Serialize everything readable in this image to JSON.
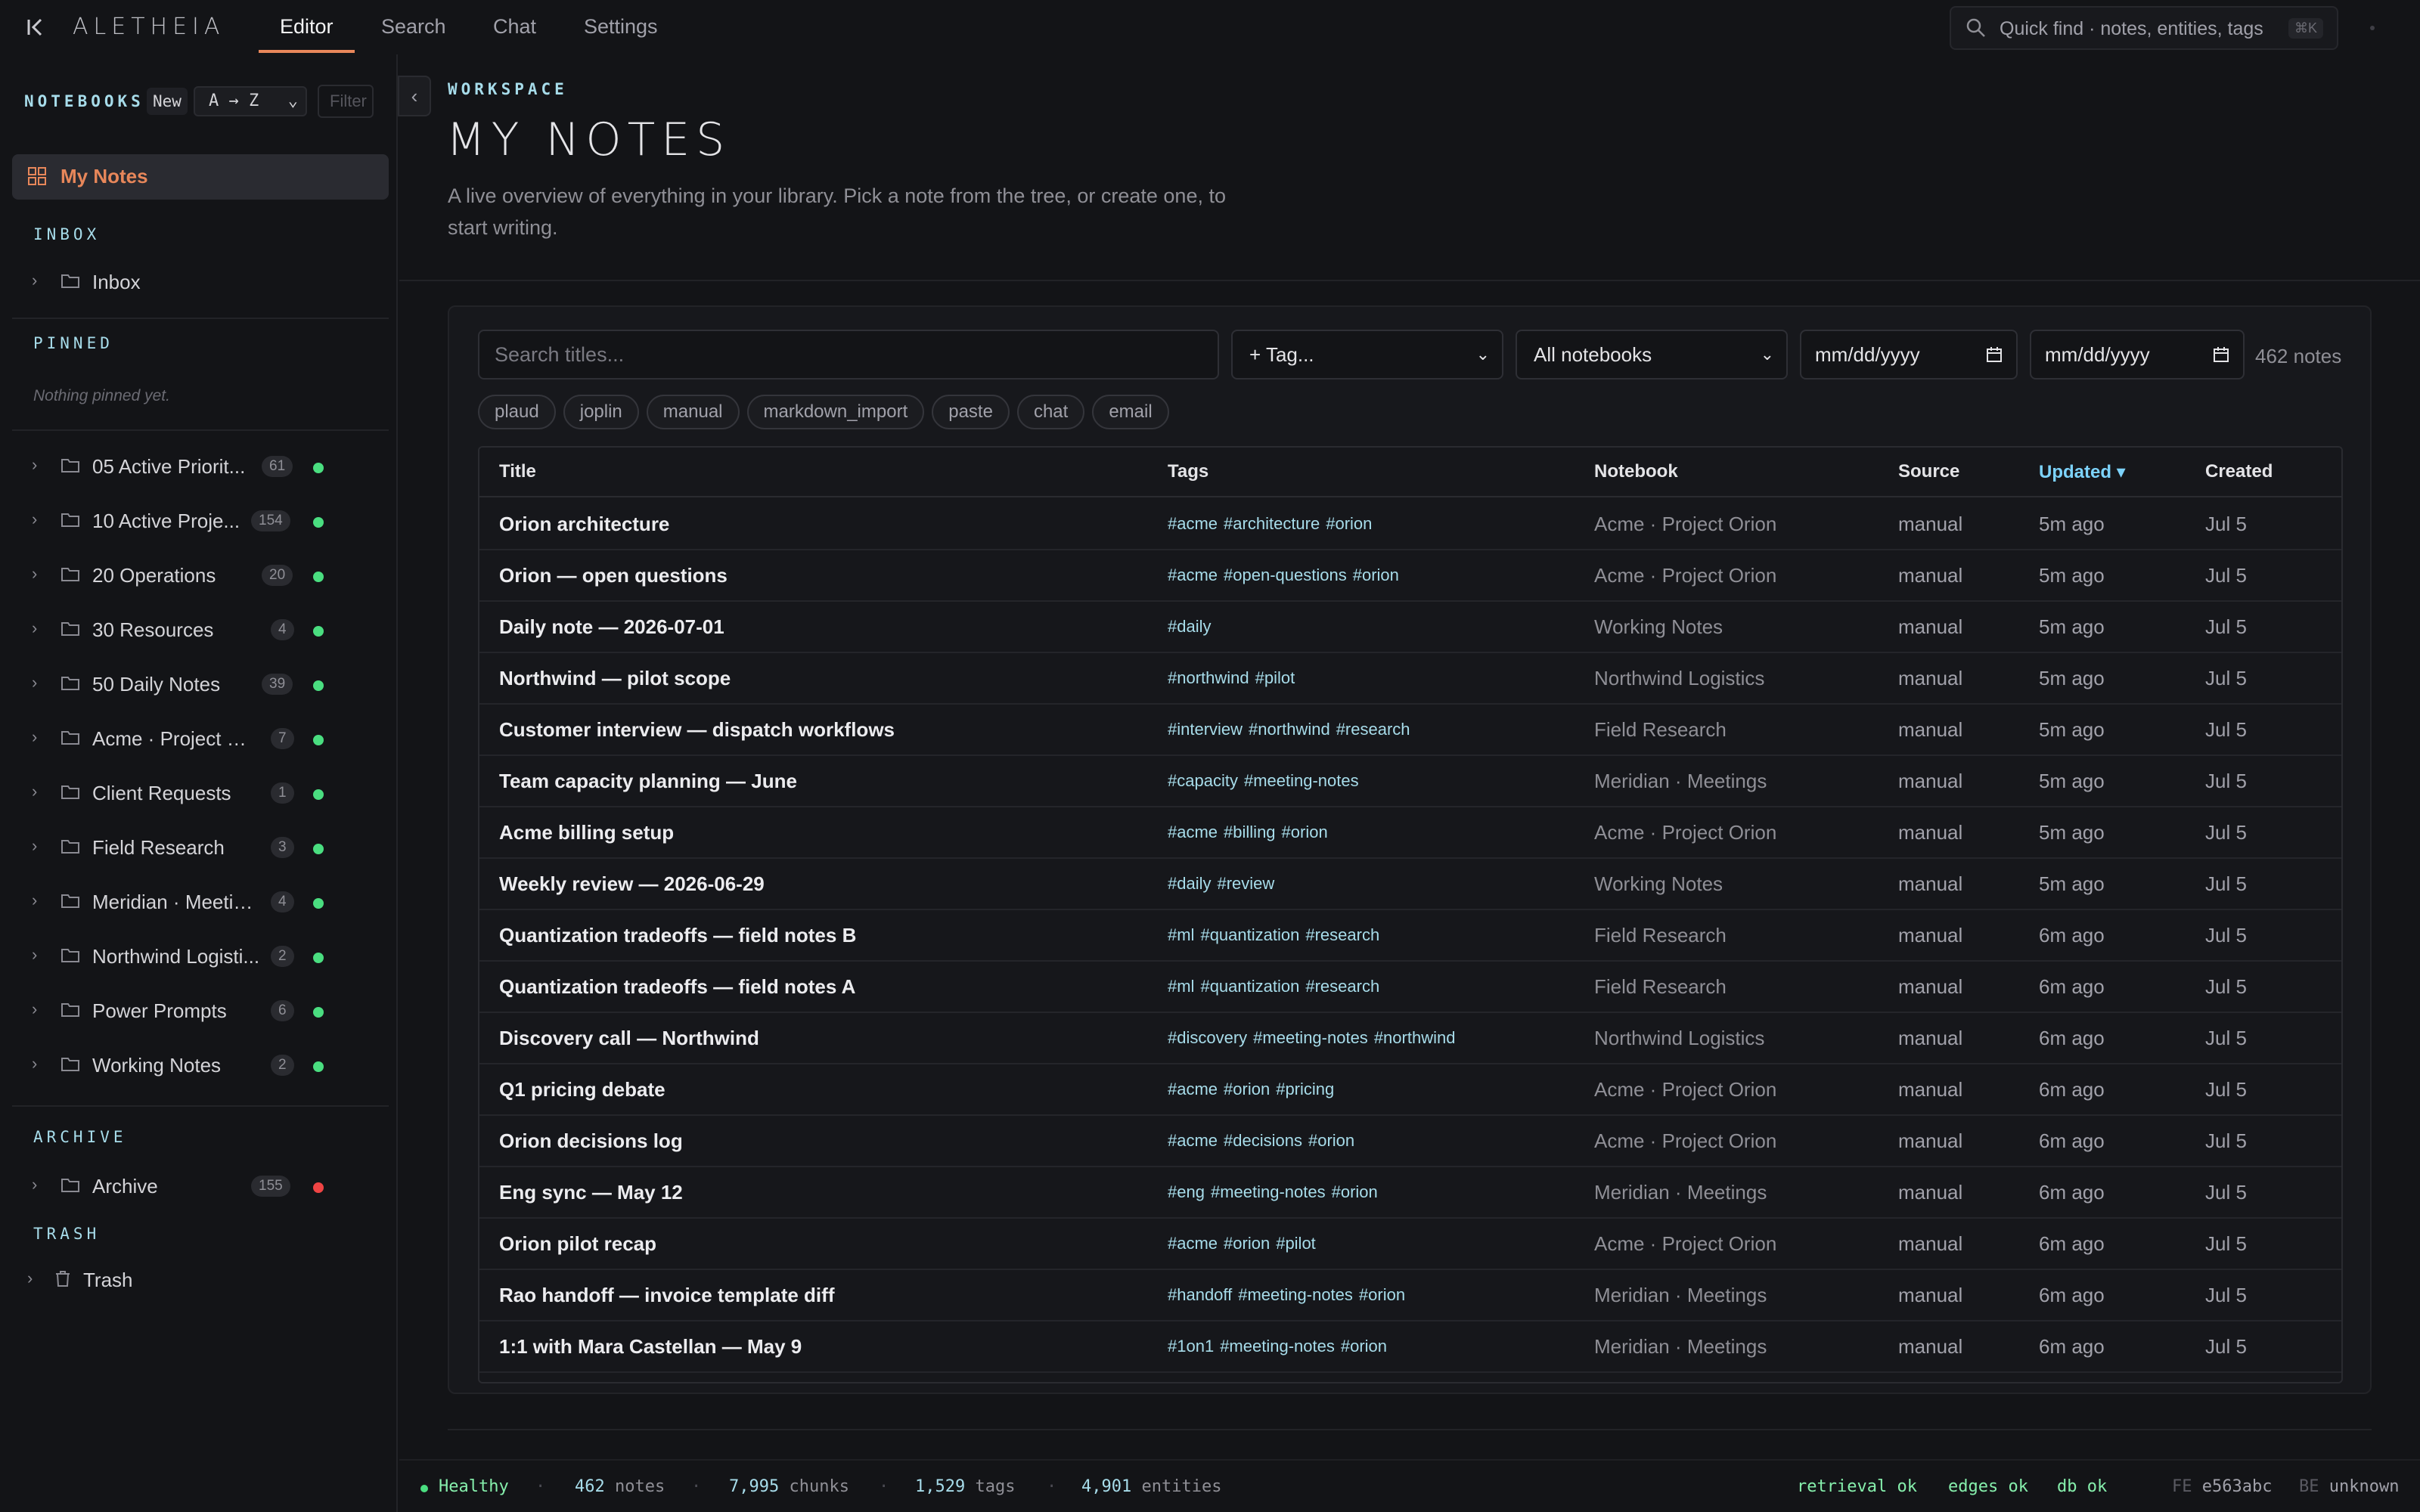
{
  "app": {
    "brand": "ALETHEIA",
    "nav": [
      "Editor",
      "Search",
      "Chat",
      "Settings"
    ],
    "active_tab": "Editor",
    "quick_find": {
      "label": "Quick find · notes, entities, tags",
      "shortcut": "⌘K"
    }
  },
  "sidebar": {
    "header": "NOTEBOOKS",
    "new_label": "New",
    "sort_value": "A → Z",
    "filter_placeholder": "Filter",
    "my_notes": "My Notes",
    "inbox_label": "INBOX",
    "inbox_item": "Inbox",
    "pinned_label": "PINNED",
    "pinned_empty": "Nothing pinned yet.",
    "notebooks": [
      {
        "name": "05 Active Priorit...",
        "count": "61"
      },
      {
        "name": "10 Active Proje...",
        "count": "154"
      },
      {
        "name": "20 Operations",
        "count": "20"
      },
      {
        "name": "30 Resources",
        "count": "4"
      },
      {
        "name": "50 Daily Notes",
        "count": "39"
      },
      {
        "name": "Acme · Project Or...",
        "count": "7"
      },
      {
        "name": "Client Requests",
        "count": "1"
      },
      {
        "name": "Field Research",
        "count": "3"
      },
      {
        "name": "Meridian · Meetin...",
        "count": "4"
      },
      {
        "name": "Northwind Logisti...",
        "count": "2"
      },
      {
        "name": "Power Prompts",
        "count": "6"
      },
      {
        "name": "Working Notes",
        "count": "2"
      }
    ],
    "archive_label": "ARCHIVE",
    "archive_item": {
      "name": "Archive",
      "count": "155"
    },
    "trash_label": "TRASH",
    "trash_item": "Trash",
    "status_colors": {
      "active": "#4ade80",
      "archived": "#ef4444"
    }
  },
  "main": {
    "eyebrow": "WORKSPACE",
    "title": "MY NOTES",
    "subtitle": "A live overview of everything in your library. Pick a note from the tree, or create one, to start writing.",
    "search_placeholder": "Search titles...",
    "tag_select": "+ Tag...",
    "notebook_select": "All notebooks",
    "date_from": "mm/dd/yyyy",
    "date_to": "mm/dd/yyyy",
    "note_count": "462 notes",
    "source_chips": [
      "plaud",
      "joplin",
      "manual",
      "markdown_import",
      "paste",
      "chat",
      "email"
    ],
    "table": {
      "columns": [
        "Title",
        "Tags",
        "Notebook",
        "Source",
        "Updated ▾",
        "Created"
      ],
      "rows": [
        {
          "title": "Orion architecture",
          "tags": [
            "#acme",
            "#architecture",
            "#orion"
          ],
          "notebook": "Acme · Project Orion",
          "source": "manual",
          "updated": "5m ago",
          "created": "Jul 5"
        },
        {
          "title": "Orion — open questions",
          "tags": [
            "#acme",
            "#open-questions",
            "#orion"
          ],
          "notebook": "Acme · Project Orion",
          "source": "manual",
          "updated": "5m ago",
          "created": "Jul 5"
        },
        {
          "title": "Daily note — 2026-07-01",
          "tags": [
            "#daily"
          ],
          "notebook": "Working Notes",
          "source": "manual",
          "updated": "5m ago",
          "created": "Jul 5"
        },
        {
          "title": "Northwind — pilot scope",
          "tags": [
            "#northwind",
            "#pilot"
          ],
          "notebook": "Northwind Logistics",
          "source": "manual",
          "updated": "5m ago",
          "created": "Jul 5"
        },
        {
          "title": "Customer interview — dispatch workflows",
          "tags": [
            "#interview",
            "#northwind",
            "#research"
          ],
          "notebook": "Field Research",
          "source": "manual",
          "updated": "5m ago",
          "created": "Jul 5"
        },
        {
          "title": "Team capacity planning — June",
          "tags": [
            "#capacity",
            "#meeting-notes"
          ],
          "notebook": "Meridian · Meetings",
          "source": "manual",
          "updated": "5m ago",
          "created": "Jul 5"
        },
        {
          "title": "Acme billing setup",
          "tags": [
            "#acme",
            "#billing",
            "#orion"
          ],
          "notebook": "Acme · Project Orion",
          "source": "manual",
          "updated": "5m ago",
          "created": "Jul 5"
        },
        {
          "title": "Weekly review — 2026-06-29",
          "tags": [
            "#daily",
            "#review"
          ],
          "notebook": "Working Notes",
          "source": "manual",
          "updated": "5m ago",
          "created": "Jul 5"
        },
        {
          "title": "Quantization tradeoffs — field notes B",
          "tags": [
            "#ml",
            "#quantization",
            "#research"
          ],
          "notebook": "Field Research",
          "source": "manual",
          "updated": "6m ago",
          "created": "Jul 5"
        },
        {
          "title": "Quantization tradeoffs — field notes A",
          "tags": [
            "#ml",
            "#quantization",
            "#research"
          ],
          "notebook": "Field Research",
          "source": "manual",
          "updated": "6m ago",
          "created": "Jul 5"
        },
        {
          "title": "Discovery call — Northwind",
          "tags": [
            "#discovery",
            "#meeting-notes",
            "#northwind"
          ],
          "notebook": "Northwind Logistics",
          "source": "manual",
          "updated": "6m ago",
          "created": "Jul 5"
        },
        {
          "title": "Q1 pricing debate",
          "tags": [
            "#acme",
            "#orion",
            "#pricing"
          ],
          "notebook": "Acme · Project Orion",
          "source": "manual",
          "updated": "6m ago",
          "created": "Jul 5"
        },
        {
          "title": "Orion decisions log",
          "tags": [
            "#acme",
            "#decisions",
            "#orion"
          ],
          "notebook": "Acme · Project Orion",
          "source": "manual",
          "updated": "6m ago",
          "created": "Jul 5"
        },
        {
          "title": "Eng sync — May 12",
          "tags": [
            "#eng",
            "#meeting-notes",
            "#orion"
          ],
          "notebook": "Meridian · Meetings",
          "source": "manual",
          "updated": "6m ago",
          "created": "Jul 5"
        },
        {
          "title": "Orion pilot recap",
          "tags": [
            "#acme",
            "#orion",
            "#pilot"
          ],
          "notebook": "Acme · Project Orion",
          "source": "manual",
          "updated": "6m ago",
          "created": "Jul 5"
        },
        {
          "title": "Rao handoff — invoice template diff",
          "tags": [
            "#handoff",
            "#meeting-notes",
            "#orion"
          ],
          "notebook": "Meridian · Meetings",
          "source": "manual",
          "updated": "6m ago",
          "created": "Jul 5"
        },
        {
          "title": "1:1 with Mara Castellan — May 9",
          "tags": [
            "#1on1",
            "#meeting-notes",
            "#orion"
          ],
          "notebook": "Meridian · Meetings",
          "source": "manual",
          "updated": "6m ago",
          "created": "Jul 5"
        }
      ]
    }
  },
  "status": {
    "health": "Healthy",
    "notes_n": "462",
    "notes_l": "notes",
    "chunks_n": "7,995",
    "chunks_l": "chunks",
    "tags_n": "1,529",
    "tags_l": "tags",
    "entities_n": "4,901",
    "entities_l": "entities",
    "retrieval": "retrieval ok",
    "edges": "edges ok",
    "db": "db ok",
    "fe_label": "FE",
    "fe_value": "e563abc",
    "be_label": "BE",
    "be_value": "unknown"
  }
}
